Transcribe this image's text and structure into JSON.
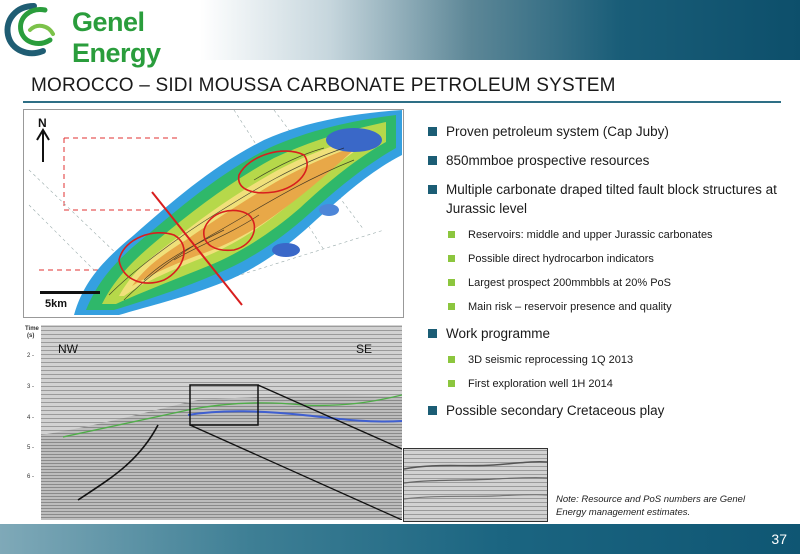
{
  "header": {
    "logo_text": "Genel Energy"
  },
  "title": "MOROCCO – SIDI MOUSSA CARBONATE PETROLEUM SYSTEM",
  "map": {
    "north_label": "N",
    "scale_label": "5km"
  },
  "seismic": {
    "axis_title": "Time",
    "axis_unit": "(s)",
    "ticks": [
      "2 -",
      "3 -",
      "4 -",
      "5 -",
      "6 -"
    ],
    "left_label": "NW",
    "right_label": "SE"
  },
  "bullets": {
    "b1": "Proven petroleum system (Cap Juby)",
    "b2": "850mmboe prospective resources",
    "b3": "Multiple carbonate draped tilted fault block structures at Jurassic level",
    "b3_sub": [
      "Reservoirs: middle and upper Jurassic carbonates",
      "Possible direct hydrocarbon indicators",
      "Largest prospect 200mmbbls at 20% PoS",
      "Main risk – reservoir presence and quality"
    ],
    "b4": "Work programme",
    "b4_sub": [
      "3D seismic reprocessing 1Q 2013",
      "First exploration well 1H 2014"
    ],
    "b5": "Possible secondary Cretaceous play"
  },
  "note": "Note: Resource and PoS numbers are Genel Energy management estimates.",
  "footer": {
    "page_number": "37"
  },
  "colors": {
    "accent": "#1b5d75",
    "sub_bullet": "#8cc63e",
    "logo_green": "#2a9d3c"
  }
}
